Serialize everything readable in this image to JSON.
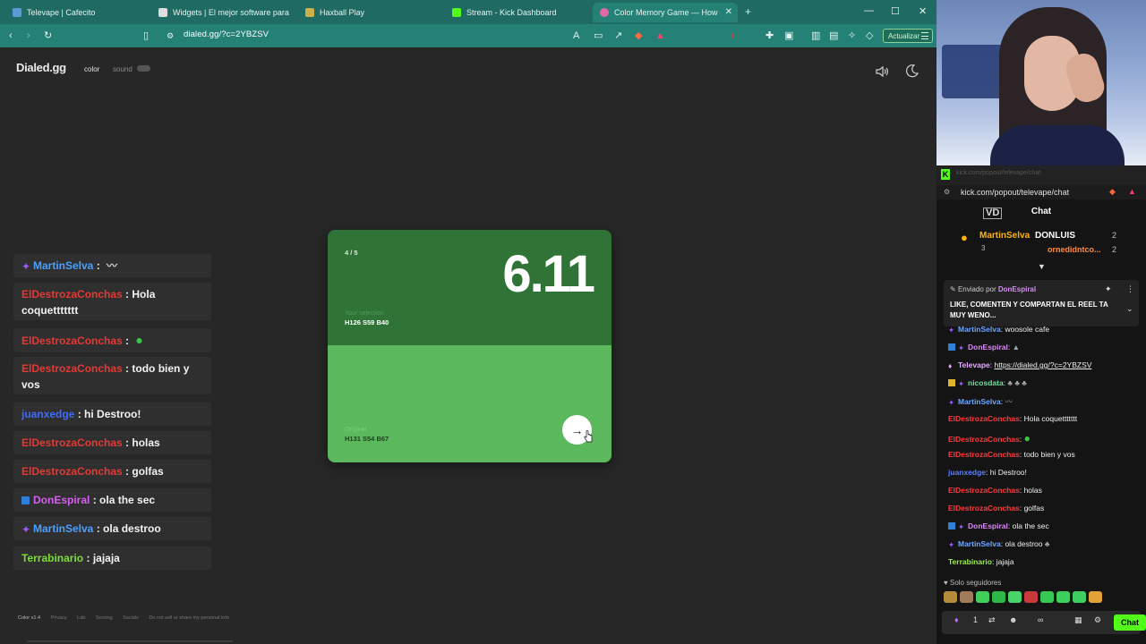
{
  "browser": {
    "tabs": [
      {
        "label": "Televape | Cafecito",
        "color": "#5b9bd5"
      },
      {
        "label": "Widgets | El mejor software para potenciar",
        "color": "#dddddd"
      },
      {
        "label": "Haxball Play",
        "color": "#c9b04a"
      },
      {
        "label": "Stream - Kick Dashboard",
        "color": "#53fc18"
      },
      {
        "label": "Color Memory Game — How",
        "color": "#e06aa8"
      }
    ],
    "new_tab": "+",
    "url": "dialed.gg/?c=2YBZSV",
    "update_label": "Actualizar"
  },
  "site": {
    "logo": "Dialed.gg",
    "nav_color": "color",
    "nav_sound": "sound",
    "footer": [
      "Color v1.4",
      "Privacy",
      "Lab",
      "Scoring",
      "Socials",
      "Do not sell or share my personal info"
    ]
  },
  "game": {
    "round": "4 / 5",
    "score": "6.11",
    "selection_label": "Your selection",
    "selection_value": "H126 S59 B40",
    "original_label": "Original",
    "original_value": "H131 S54 B67",
    "next_arrow": "→",
    "selection_color": "#2f7436",
    "original_color": "#5cb85d"
  },
  "overlay_chat": [
    {
      "user": "MartinSelva",
      "color": "#4aa0ff",
      "text": "",
      "emote": "〰"
    },
    {
      "user": "ElDestrozaConchas",
      "color": "#e53935",
      "text": "Hola coquettttttt",
      "emote": ""
    },
    {
      "user": "ElDestrozaConchas",
      "color": "#e53935",
      "text": "",
      "emote": "●"
    },
    {
      "user": "ElDestrozaConchas",
      "color": "#e53935",
      "text": "todo bien y vos",
      "emote": ""
    },
    {
      "user": "juanxedge",
      "color": "#3f6bff",
      "text": "hi Destroo!",
      "emote": ""
    },
    {
      "user": "ElDestrozaConchas",
      "color": "#e53935",
      "text": "holas",
      "emote": ""
    },
    {
      "user": "ElDestrozaConchas",
      "color": "#e53935",
      "text": "golfas",
      "emote": ""
    },
    {
      "user": "DonEspiral",
      "color": "#d65ef0",
      "text": "ola the sec",
      "emote": ""
    },
    {
      "user": "MartinSelva",
      "color": "#4aa0ff",
      "text": "ola destroo",
      "emote": ""
    },
    {
      "user": "Terrabinario",
      "color": "#7ddc3a",
      "text": "jajaja",
      "emote": ""
    }
  ],
  "kick": {
    "url": "kick.com/popout/televape/chat",
    "faint_tab": "kick.com/popout/televape/chat",
    "title": "Chat",
    "leaders": [
      {
        "name": "MartinSelva",
        "count": "3"
      },
      {
        "name": "DONLUIS",
        "count": "2"
      },
      {
        "name": "ornedidntco...",
        "count": "2"
      }
    ],
    "pinned_by_label": "Enviado por",
    "pinned_by_user": "DonEspiral",
    "pinned_text": "LIKE, COMENTEN Y COMPARTAN EL REEL TA MUY WENO...",
    "messages": [
      {
        "user": "MartinSelva",
        "color": "#6fa8ff",
        "text": "woosole cafe"
      },
      {
        "user": "DonEspiral",
        "color": "#d98cf5",
        "text": ""
      },
      {
        "user": "Televape",
        "color": "#e6a9ff",
        "text": "https://dialed.gg/?c=2YBZSV"
      },
      {
        "user": "nicosdata",
        "color": "#6fe0a0",
        "text": ""
      },
      {
        "user": "MartinSelva",
        "color": "#6fa8ff",
        "text": ""
      },
      {
        "user": "ElDestrozaConchas",
        "color": "#ff3b3b",
        "text": "Hola coquettttttt"
      },
      {
        "user": "ElDestrozaConchas",
        "color": "#ff3b3b",
        "text": ""
      },
      {
        "user": "ElDestrozaConchas",
        "color": "#ff3b3b",
        "text": "todo bien y vos"
      },
      {
        "user": "juanxedge",
        "color": "#5c7dff",
        "text": "hi Destroo!"
      },
      {
        "user": "ElDestrozaConchas",
        "color": "#ff3b3b",
        "text": "holas"
      },
      {
        "user": "ElDestrozaConchas",
        "color": "#ff3b3b",
        "text": "golfas"
      },
      {
        "user": "DonEspiral",
        "color": "#d98cf5",
        "text": "ola the sec"
      },
      {
        "user": "MartinSelva",
        "color": "#6fa8ff",
        "text": "ola destroo"
      },
      {
        "user": "Terrabinario",
        "color": "#9bef4a",
        "text": "jajaja"
      }
    ],
    "followers_only": "Solo seguidores",
    "input_count": "1",
    "send_label": "Chat",
    "accent": "#53fc18"
  }
}
